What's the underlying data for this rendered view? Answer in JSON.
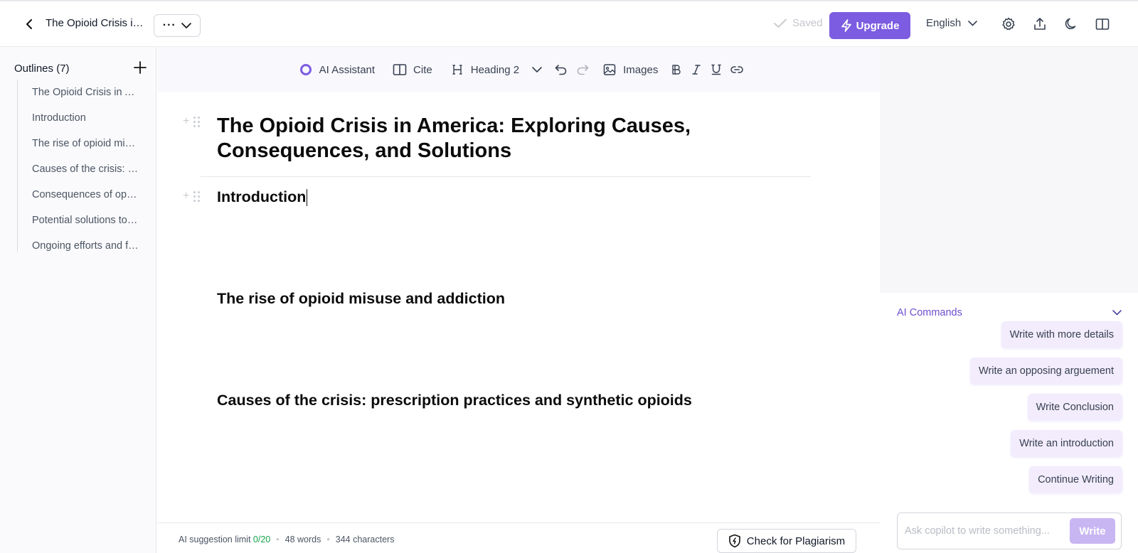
{
  "header": {
    "doc_title": "The Opioid Crisis in America: Exploring Causes, Consequences, and Solutions",
    "more_label": "···",
    "saved_label": "Saved",
    "upgrade_label": "Upgrade",
    "language": "English",
    "accent_color": "#7c5ce0"
  },
  "sidebar": {
    "outlines_label": "Outlines",
    "outlines_count": "(7)",
    "items": [
      {
        "label": "The Opioid Crisis in America: Exploring Causes, Consequences, and Solutions"
      },
      {
        "label": "Introduction"
      },
      {
        "label": "The rise of opioid misuse and addiction"
      },
      {
        "label": "Causes of the crisis: prescription practices and synthetic opioids"
      },
      {
        "label": "Consequences of opioid addiction"
      },
      {
        "label": "Potential solutions to the crisis"
      },
      {
        "label": "Ongoing efforts and future outlook"
      }
    ]
  },
  "toolbar": {
    "ai_assistant": "AI Assistant",
    "cite": "Cite",
    "heading": "Heading 2",
    "images": "Images"
  },
  "editor": {
    "title": "The Opioid Crisis in America: Exploring Causes, Consequences, and Solutions",
    "intro_heading": "Introduction",
    "heading_rise": "The rise of opioid misuse and addiction",
    "heading_causes": "Causes of the crisis: prescription practices and synthetic opioids"
  },
  "status": {
    "limit_label": "AI suggestion limit",
    "limit_value": "0/20",
    "words": "48 words",
    "characters": "344 characters",
    "plagiarism_label": "Check for Plagiarism"
  },
  "ai_panel": {
    "title": "AI Commands",
    "commands": [
      {
        "label": "Write with more details"
      },
      {
        "label": "Write an opposing arguement"
      },
      {
        "label": "Write Conclusion"
      },
      {
        "label": "Write an introduction"
      },
      {
        "label": "Continue Writing"
      }
    ],
    "ask_placeholder": "Ask copilot to write something...",
    "write_label": "Write"
  }
}
